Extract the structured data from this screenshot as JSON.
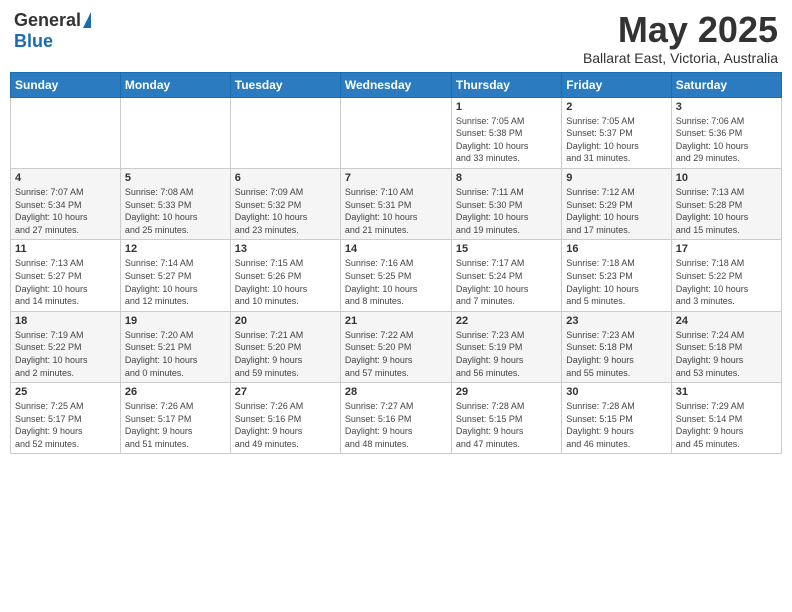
{
  "logo": {
    "general": "General",
    "blue": "Blue"
  },
  "title": {
    "month_year": "May 2025",
    "location": "Ballarat East, Victoria, Australia"
  },
  "weekdays": [
    "Sunday",
    "Monday",
    "Tuesday",
    "Wednesday",
    "Thursday",
    "Friday",
    "Saturday"
  ],
  "weeks": [
    [
      {
        "day": "",
        "info": ""
      },
      {
        "day": "",
        "info": ""
      },
      {
        "day": "",
        "info": ""
      },
      {
        "day": "",
        "info": ""
      },
      {
        "day": "1",
        "info": "Sunrise: 7:05 AM\nSunset: 5:38 PM\nDaylight: 10 hours\nand 33 minutes."
      },
      {
        "day": "2",
        "info": "Sunrise: 7:05 AM\nSunset: 5:37 PM\nDaylight: 10 hours\nand 31 minutes."
      },
      {
        "day": "3",
        "info": "Sunrise: 7:06 AM\nSunset: 5:36 PM\nDaylight: 10 hours\nand 29 minutes."
      }
    ],
    [
      {
        "day": "4",
        "info": "Sunrise: 7:07 AM\nSunset: 5:34 PM\nDaylight: 10 hours\nand 27 minutes."
      },
      {
        "day": "5",
        "info": "Sunrise: 7:08 AM\nSunset: 5:33 PM\nDaylight: 10 hours\nand 25 minutes."
      },
      {
        "day": "6",
        "info": "Sunrise: 7:09 AM\nSunset: 5:32 PM\nDaylight: 10 hours\nand 23 minutes."
      },
      {
        "day": "7",
        "info": "Sunrise: 7:10 AM\nSunset: 5:31 PM\nDaylight: 10 hours\nand 21 minutes."
      },
      {
        "day": "8",
        "info": "Sunrise: 7:11 AM\nSunset: 5:30 PM\nDaylight: 10 hours\nand 19 minutes."
      },
      {
        "day": "9",
        "info": "Sunrise: 7:12 AM\nSunset: 5:29 PM\nDaylight: 10 hours\nand 17 minutes."
      },
      {
        "day": "10",
        "info": "Sunrise: 7:13 AM\nSunset: 5:28 PM\nDaylight: 10 hours\nand 15 minutes."
      }
    ],
    [
      {
        "day": "11",
        "info": "Sunrise: 7:13 AM\nSunset: 5:27 PM\nDaylight: 10 hours\nand 14 minutes."
      },
      {
        "day": "12",
        "info": "Sunrise: 7:14 AM\nSunset: 5:27 PM\nDaylight: 10 hours\nand 12 minutes."
      },
      {
        "day": "13",
        "info": "Sunrise: 7:15 AM\nSunset: 5:26 PM\nDaylight: 10 hours\nand 10 minutes."
      },
      {
        "day": "14",
        "info": "Sunrise: 7:16 AM\nSunset: 5:25 PM\nDaylight: 10 hours\nand 8 minutes."
      },
      {
        "day": "15",
        "info": "Sunrise: 7:17 AM\nSunset: 5:24 PM\nDaylight: 10 hours\nand 7 minutes."
      },
      {
        "day": "16",
        "info": "Sunrise: 7:18 AM\nSunset: 5:23 PM\nDaylight: 10 hours\nand 5 minutes."
      },
      {
        "day": "17",
        "info": "Sunrise: 7:18 AM\nSunset: 5:22 PM\nDaylight: 10 hours\nand 3 minutes."
      }
    ],
    [
      {
        "day": "18",
        "info": "Sunrise: 7:19 AM\nSunset: 5:22 PM\nDaylight: 10 hours\nand 2 minutes."
      },
      {
        "day": "19",
        "info": "Sunrise: 7:20 AM\nSunset: 5:21 PM\nDaylight: 10 hours\nand 0 minutes."
      },
      {
        "day": "20",
        "info": "Sunrise: 7:21 AM\nSunset: 5:20 PM\nDaylight: 9 hours\nand 59 minutes."
      },
      {
        "day": "21",
        "info": "Sunrise: 7:22 AM\nSunset: 5:20 PM\nDaylight: 9 hours\nand 57 minutes."
      },
      {
        "day": "22",
        "info": "Sunrise: 7:23 AM\nSunset: 5:19 PM\nDaylight: 9 hours\nand 56 minutes."
      },
      {
        "day": "23",
        "info": "Sunrise: 7:23 AM\nSunset: 5:18 PM\nDaylight: 9 hours\nand 55 minutes."
      },
      {
        "day": "24",
        "info": "Sunrise: 7:24 AM\nSunset: 5:18 PM\nDaylight: 9 hours\nand 53 minutes."
      }
    ],
    [
      {
        "day": "25",
        "info": "Sunrise: 7:25 AM\nSunset: 5:17 PM\nDaylight: 9 hours\nand 52 minutes."
      },
      {
        "day": "26",
        "info": "Sunrise: 7:26 AM\nSunset: 5:17 PM\nDaylight: 9 hours\nand 51 minutes."
      },
      {
        "day": "27",
        "info": "Sunrise: 7:26 AM\nSunset: 5:16 PM\nDaylight: 9 hours\nand 49 minutes."
      },
      {
        "day": "28",
        "info": "Sunrise: 7:27 AM\nSunset: 5:16 PM\nDaylight: 9 hours\nand 48 minutes."
      },
      {
        "day": "29",
        "info": "Sunrise: 7:28 AM\nSunset: 5:15 PM\nDaylight: 9 hours\nand 47 minutes."
      },
      {
        "day": "30",
        "info": "Sunrise: 7:28 AM\nSunset: 5:15 PM\nDaylight: 9 hours\nand 46 minutes."
      },
      {
        "day": "31",
        "info": "Sunrise: 7:29 AM\nSunset: 5:14 PM\nDaylight: 9 hours\nand 45 minutes."
      }
    ]
  ]
}
